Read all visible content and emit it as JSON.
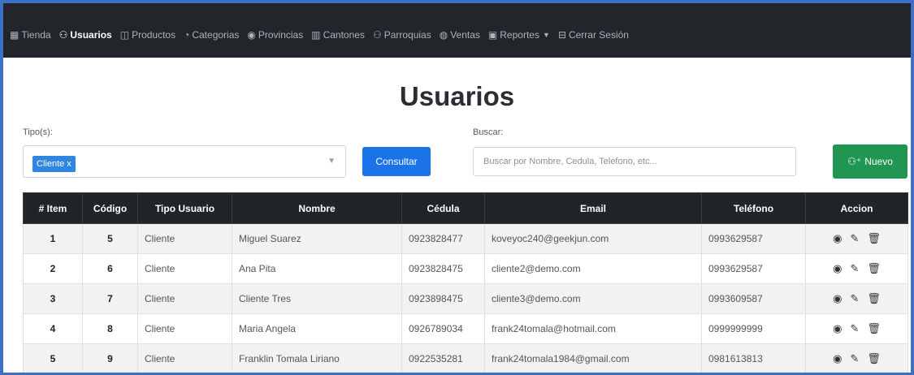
{
  "navbar": {
    "items": [
      {
        "label": "Tienda",
        "icon": "store-icon",
        "glyph": "▦",
        "active": false
      },
      {
        "label": "Usuarios",
        "icon": "users-icon",
        "glyph": "⚇",
        "active": true
      },
      {
        "label": "Productos",
        "icon": "box-icon",
        "glyph": "◫",
        "active": false
      },
      {
        "label": "Categorias",
        "icon": "tag-icon",
        "glyph": "◔",
        "active": false
      },
      {
        "label": "Provincias",
        "icon": "location-pin-icon",
        "glyph": "◉",
        "active": false
      },
      {
        "label": "Cantones",
        "icon": "columns-icon",
        "glyph": "▥",
        "active": false
      },
      {
        "label": "Parroquias",
        "icon": "people-icon",
        "glyph": "⚇",
        "active": false
      },
      {
        "label": "Ventas",
        "icon": "money-icon",
        "glyph": "◍",
        "active": false
      },
      {
        "label": "Reportes",
        "icon": "report-icon",
        "glyph": "▣",
        "active": false
      },
      {
        "label": "Cerrar Sesión",
        "icon": "logout-icon",
        "glyph": "⊟",
        "active": false
      }
    ]
  },
  "page": {
    "title": "Usuarios"
  },
  "filters": {
    "tipo_label": "Tipo(s):",
    "tipo_selected": "Cliente x",
    "consultar_label": "Consultar",
    "buscar_label": "Buscar:",
    "buscar_placeholder": "Buscar por Nombre, Cedula, Telefono, etc...",
    "buscar_value": "",
    "nuevo_label": "Nuevo"
  },
  "table": {
    "headers": [
      "# Item",
      "Código",
      "Tipo Usuario",
      "Nombre",
      "Cédula",
      "Email",
      "Teléfono",
      "Accion"
    ],
    "rows": [
      {
        "item": "1",
        "codigo": "5",
        "tipo": "Cliente",
        "nombre": "Miguel Suarez",
        "cedula": "0923828477",
        "email": "koveyoc240@geekjun.com",
        "telefono": "0993629587"
      },
      {
        "item": "2",
        "codigo": "6",
        "tipo": "Cliente",
        "nombre": "Ana Pita",
        "cedula": "0923828475",
        "email": "cliente2@demo.com",
        "telefono": "0993629587"
      },
      {
        "item": "3",
        "codigo": "7",
        "tipo": "Cliente",
        "nombre": "Cliente Tres",
        "cedula": "0923898475",
        "email": "cliente3@demo.com",
        "telefono": "0993609587"
      },
      {
        "item": "4",
        "codigo": "8",
        "tipo": "Cliente",
        "nombre": "Maria Angela",
        "cedula": "0926789034",
        "email": "frank24tomala@hotmail.com",
        "telefono": "0999999999"
      },
      {
        "item": "5",
        "codigo": "9",
        "tipo": "Cliente",
        "nombre": "Franklin Tomala Liriano",
        "cedula": "0922535281",
        "email": "frank24tomala1984@gmail.com",
        "telefono": "0981613813"
      }
    ],
    "action_icons": [
      "eye-icon",
      "edit-icon",
      "trash-icon"
    ]
  },
  "colors": {
    "navbar_bg": "#22252a",
    "primary": "#1a73e8",
    "success": "#219653",
    "table_header": "#212529",
    "frame_border": "#3d6fc4"
  }
}
